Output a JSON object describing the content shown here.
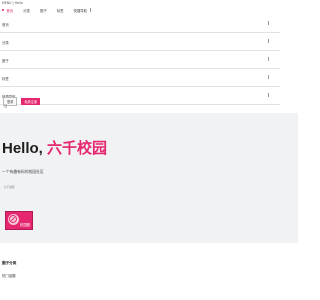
{
  "page": {
    "title": "MENU | Hello"
  },
  "topnav": {
    "items": [
      {
        "label": "首页",
        "active": true
      },
      {
        "label": "分类",
        "active": false
      },
      {
        "label": "圈子",
        "active": false
      },
      {
        "label": "标签",
        "active": false
      },
      {
        "label": "快捷导航",
        "active": false
      }
    ]
  },
  "menu": {
    "rows": [
      {
        "label": "首页"
      },
      {
        "label": "分类"
      },
      {
        "label": "圈子"
      },
      {
        "label": "标签"
      },
      {
        "label": "快捷导航"
      }
    ]
  },
  "auth": {
    "login_label": "登录",
    "register_label": "免费注册",
    "mark": "注"
  },
  "hero": {
    "greeting": "Hello,",
    "brand": "六千校园",
    "subtitle": "一个有趣有料的校园社区",
    "tiny_text": "六千校园",
    "app_label": "校园圈"
  },
  "sections": {
    "first_heading": "圈子分类",
    "second_heading": "热门话题"
  },
  "colors": {
    "accent": "#e6266e",
    "hero_bg": "#f1f2f4"
  }
}
